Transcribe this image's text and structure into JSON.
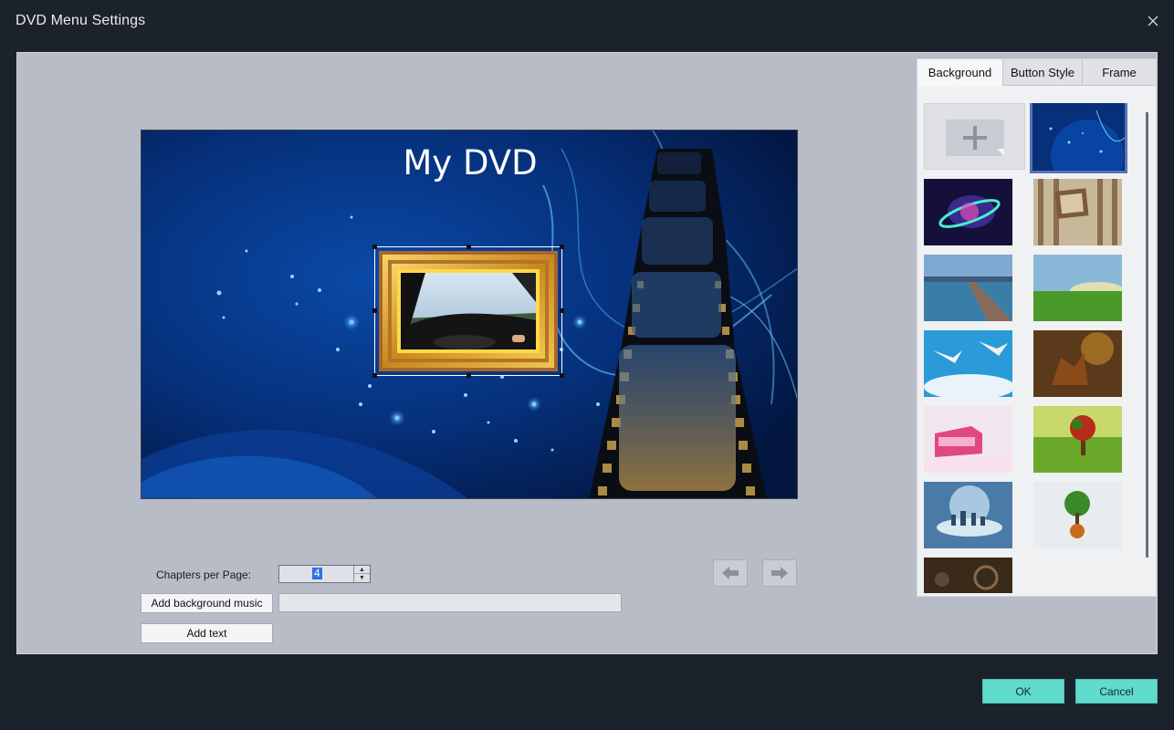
{
  "window": {
    "title": "DVD Menu Settings",
    "close_icon": "close-icon"
  },
  "preview": {
    "menu_title": "My DVD"
  },
  "controls": {
    "chapters_label": "Chapters per Page:",
    "chapters_value": "4",
    "add_music_label": "Add background music",
    "add_text_label": "Add text",
    "music_path": ""
  },
  "side_panel": {
    "tabs": [
      {
        "label": "Background",
        "active": true
      },
      {
        "label": "Button Style",
        "active": false
      },
      {
        "label": "Frame",
        "active": false
      }
    ],
    "add_icon": "plus-icon",
    "backgrounds": [
      "blue-particles",
      "galaxy-ring",
      "striped-wall-frame",
      "pier-lake",
      "green-field",
      "seagulls-sky",
      "surreal-brown",
      "pink-house",
      "fantasy-tree-meadow",
      "crystal-planet-city",
      "floating-tree",
      "vintage-film"
    ]
  },
  "footer": {
    "ok_label": "OK",
    "cancel_label": "Cancel"
  },
  "colors": {
    "accent": "#5fdccb",
    "window_bg": "#1c222c",
    "panel_bg": "#b8bcc7",
    "selection": "#5a72b8"
  }
}
